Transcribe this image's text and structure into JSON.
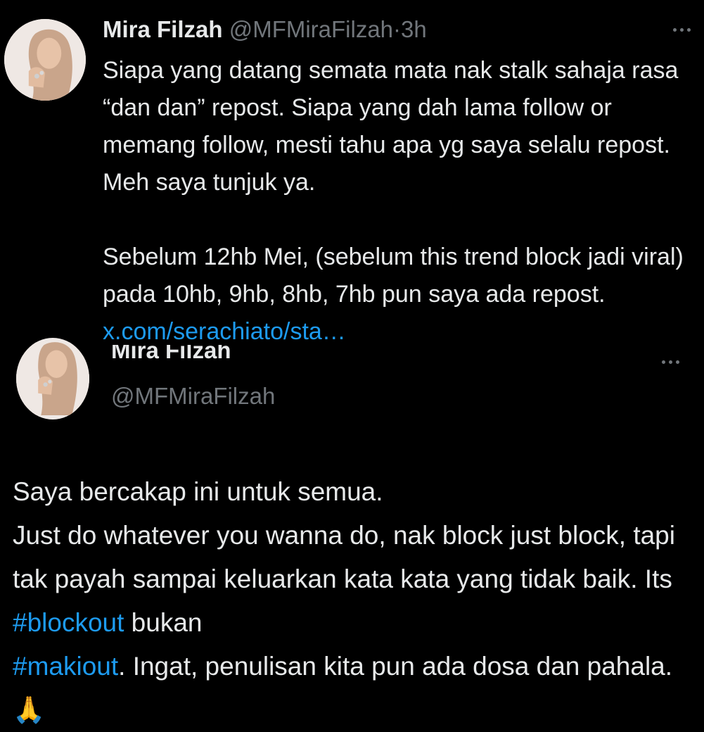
{
  "tweet1": {
    "display_name": "Mira Filzah",
    "handle": "@MFMiraFilzah",
    "separator": "·",
    "time": "3h",
    "text_part1": "Siapa yang datang semata mata nak stalk sahaja rasa “dan dan” repost. Siapa yang dah lama follow or memang follow, mesti tahu apa yg saya selalu repost. Meh saya tunjuk ya.\n\nSebelum 12hb Mei, (sebelum this trend block jadi viral) pada 10hb, 9hb, 8hb, 7hb pun saya ada repost. ",
    "link_text": "x.com/serachiato/sta…",
    "more_icon": "ellipsis-icon"
  },
  "tweet2": {
    "display_name": "Mira Filzah",
    "handle": "@MFMiraFilzah",
    "text_part1": "Saya bercakap ini untuk semua.\nJust do whatever you wanna do, nak block just block, tapi tak payah sampai keluarkan kata kata yang tidak baik. Its ",
    "hashtag1": "#blockout",
    "text_part2": " bukan\n",
    "hashtag2": "#makiout",
    "text_part3": ". Ingat, penulisan kita pun ada dosa dan pahala. ",
    "emoji": "🙏",
    "more_icon": "ellipsis-icon"
  },
  "colors": {
    "background": "#000000",
    "text": "#e7e9ea",
    "secondary": "#71767b",
    "accent": "#1d9bf0"
  }
}
